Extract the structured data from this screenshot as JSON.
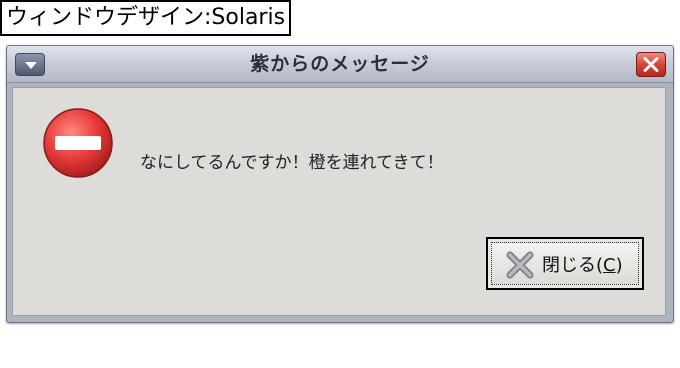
{
  "caption": "ウィンドウデザイン:Solaris",
  "dialog": {
    "title": "紫からのメッセージ",
    "message": "なにしてるんですか！橙を連れてきて！",
    "close_button": {
      "label_prefix": "閉じる(",
      "mnemonic": "C",
      "label_suffix": ")"
    }
  },
  "icons": {
    "window_menu": "window-menu-icon",
    "window_close": "close-icon",
    "message": "error-stop-icon",
    "button": "x-icon"
  },
  "colors": {
    "titlebar": "#c9ced8",
    "body": "#dedcd8",
    "close_red": "#d7463a",
    "error_red": "#e63a3a"
  }
}
